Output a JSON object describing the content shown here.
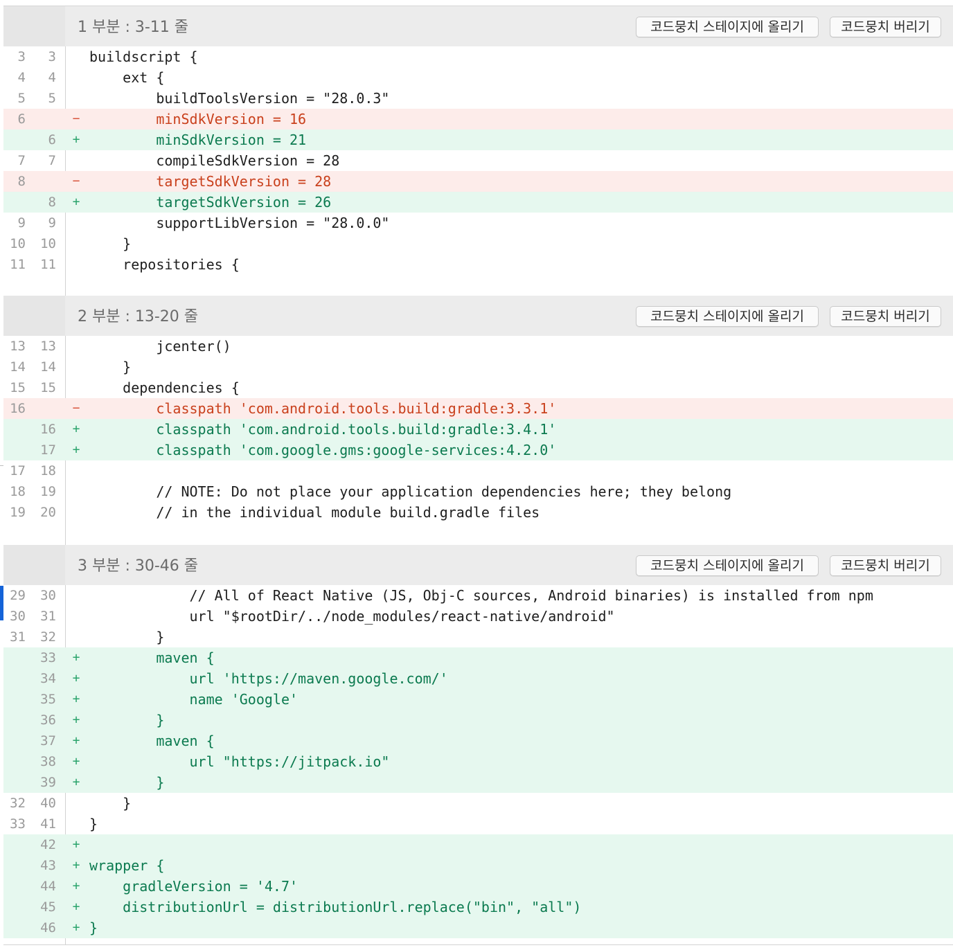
{
  "hunks": [
    {
      "title": "1 부분 : 3-11 줄",
      "stage_label": "코드뭉치 스테이지에 올리기",
      "discard_label": "코드뭉치 버리기",
      "lines": [
        {
          "old": "3",
          "new": "3",
          "type": "ctx",
          "marker": "",
          "code": "buildscript {"
        },
        {
          "old": "4",
          "new": "4",
          "type": "ctx",
          "marker": "",
          "code": "    ext {"
        },
        {
          "old": "5",
          "new": "5",
          "type": "ctx",
          "marker": "",
          "code": "        buildToolsVersion = \"28.0.3\""
        },
        {
          "old": "6",
          "new": "",
          "type": "del",
          "marker": "−",
          "code": "        minSdkVersion = 16"
        },
        {
          "old": "",
          "new": "6",
          "type": "add",
          "marker": "+",
          "code": "        minSdkVersion = 21"
        },
        {
          "old": "7",
          "new": "7",
          "type": "ctx",
          "marker": "",
          "code": "        compileSdkVersion = 28"
        },
        {
          "old": "8",
          "new": "",
          "type": "del",
          "marker": "−",
          "code": "        targetSdkVersion = 28"
        },
        {
          "old": "",
          "new": "8",
          "type": "add",
          "marker": "+",
          "code": "        targetSdkVersion = 26"
        },
        {
          "old": "9",
          "new": "9",
          "type": "ctx",
          "marker": "",
          "code": "        supportLibVersion = \"28.0.0\""
        },
        {
          "old": "10",
          "new": "10",
          "type": "ctx",
          "marker": "",
          "code": "    }"
        },
        {
          "old": "11",
          "new": "11",
          "type": "ctx",
          "marker": "",
          "code": "    repositories {"
        }
      ]
    },
    {
      "title": "2 부분 : 13-20 줄",
      "stage_label": "코드뭉치 스테이지에 올리기",
      "discard_label": "코드뭉치 버리기",
      "lines": [
        {
          "old": "13",
          "new": "13",
          "type": "ctx",
          "marker": "",
          "code": "        jcenter()"
        },
        {
          "old": "14",
          "new": "14",
          "type": "ctx",
          "marker": "",
          "code": "    }"
        },
        {
          "old": "15",
          "new": "15",
          "type": "ctx",
          "marker": "",
          "code": "    dependencies {"
        },
        {
          "old": "16",
          "new": "",
          "type": "del",
          "marker": "−",
          "code": "        classpath 'com.android.tools.build:gradle:3.3.1'"
        },
        {
          "old": "",
          "new": "16",
          "type": "add",
          "marker": "+",
          "code": "        classpath 'com.android.tools.build:gradle:3.4.1'"
        },
        {
          "old": "",
          "new": "17",
          "type": "add",
          "marker": "+",
          "code": "        classpath 'com.google.gms:google-services:4.2.0'"
        },
        {
          "old": "17",
          "new": "18",
          "type": "ctx",
          "marker": "",
          "code": ""
        },
        {
          "old": "18",
          "new": "19",
          "type": "ctx",
          "marker": "",
          "code": "        // NOTE: Do not place your application dependencies here; they belong"
        },
        {
          "old": "19",
          "new": "20",
          "type": "ctx",
          "marker": "",
          "code": "        // in the individual module build.gradle files"
        }
      ]
    },
    {
      "title": "3 부분 : 30-46 줄",
      "stage_label": "코드뭉치 스테이지에 올리기",
      "discard_label": "코드뭉치 버리기",
      "lines": [
        {
          "old": "29",
          "new": "30",
          "type": "ctx",
          "marker": "",
          "code": "            // All of React Native (JS, Obj-C sources, Android binaries) is installed from npm"
        },
        {
          "old": "30",
          "new": "31",
          "type": "ctx",
          "marker": "",
          "code": "            url \"$rootDir/../node_modules/react-native/android\""
        },
        {
          "old": "31",
          "new": "32",
          "type": "ctx",
          "marker": "",
          "code": "        }"
        },
        {
          "old": "",
          "new": "33",
          "type": "add",
          "marker": "+",
          "code": "        maven {"
        },
        {
          "old": "",
          "new": "34",
          "type": "add",
          "marker": "+",
          "code": "            url 'https://maven.google.com/'"
        },
        {
          "old": "",
          "new": "35",
          "type": "add",
          "marker": "+",
          "code": "            name 'Google'"
        },
        {
          "old": "",
          "new": "36",
          "type": "add",
          "marker": "+",
          "code": "        }"
        },
        {
          "old": "",
          "new": "37",
          "type": "add",
          "marker": "+",
          "code": "        maven {"
        },
        {
          "old": "",
          "new": "38",
          "type": "add",
          "marker": "+",
          "code": "            url \"https://jitpack.io\""
        },
        {
          "old": "",
          "new": "39",
          "type": "add",
          "marker": "+",
          "code": "        }"
        },
        {
          "old": "32",
          "new": "40",
          "type": "ctx",
          "marker": "",
          "code": "    }"
        },
        {
          "old": "33",
          "new": "41",
          "type": "ctx",
          "marker": "",
          "code": "}"
        },
        {
          "old": "",
          "new": "42",
          "type": "add",
          "marker": "+",
          "code": ""
        },
        {
          "old": "",
          "new": "43",
          "type": "add",
          "marker": "+",
          "code": "wrapper {"
        },
        {
          "old": "",
          "new": "44",
          "type": "add",
          "marker": "+",
          "code": "    gradleVersion = '4.7'"
        },
        {
          "old": "",
          "new": "45",
          "type": "add",
          "marker": "+",
          "code": "    distributionUrl = distributionUrl.replace(\"bin\", \"all\")"
        },
        {
          "old": "",
          "new": "46",
          "type": "add",
          "marker": "+",
          "code": "}"
        }
      ]
    }
  ],
  "colors": {
    "deleted_bg": "#fdecea",
    "deleted_text": "#c9401c",
    "added_bg": "#e6f8ef",
    "added_text": "#0b7a4f",
    "hunk_header_bg": "#ececec",
    "selection_accent": "#1463d8"
  }
}
